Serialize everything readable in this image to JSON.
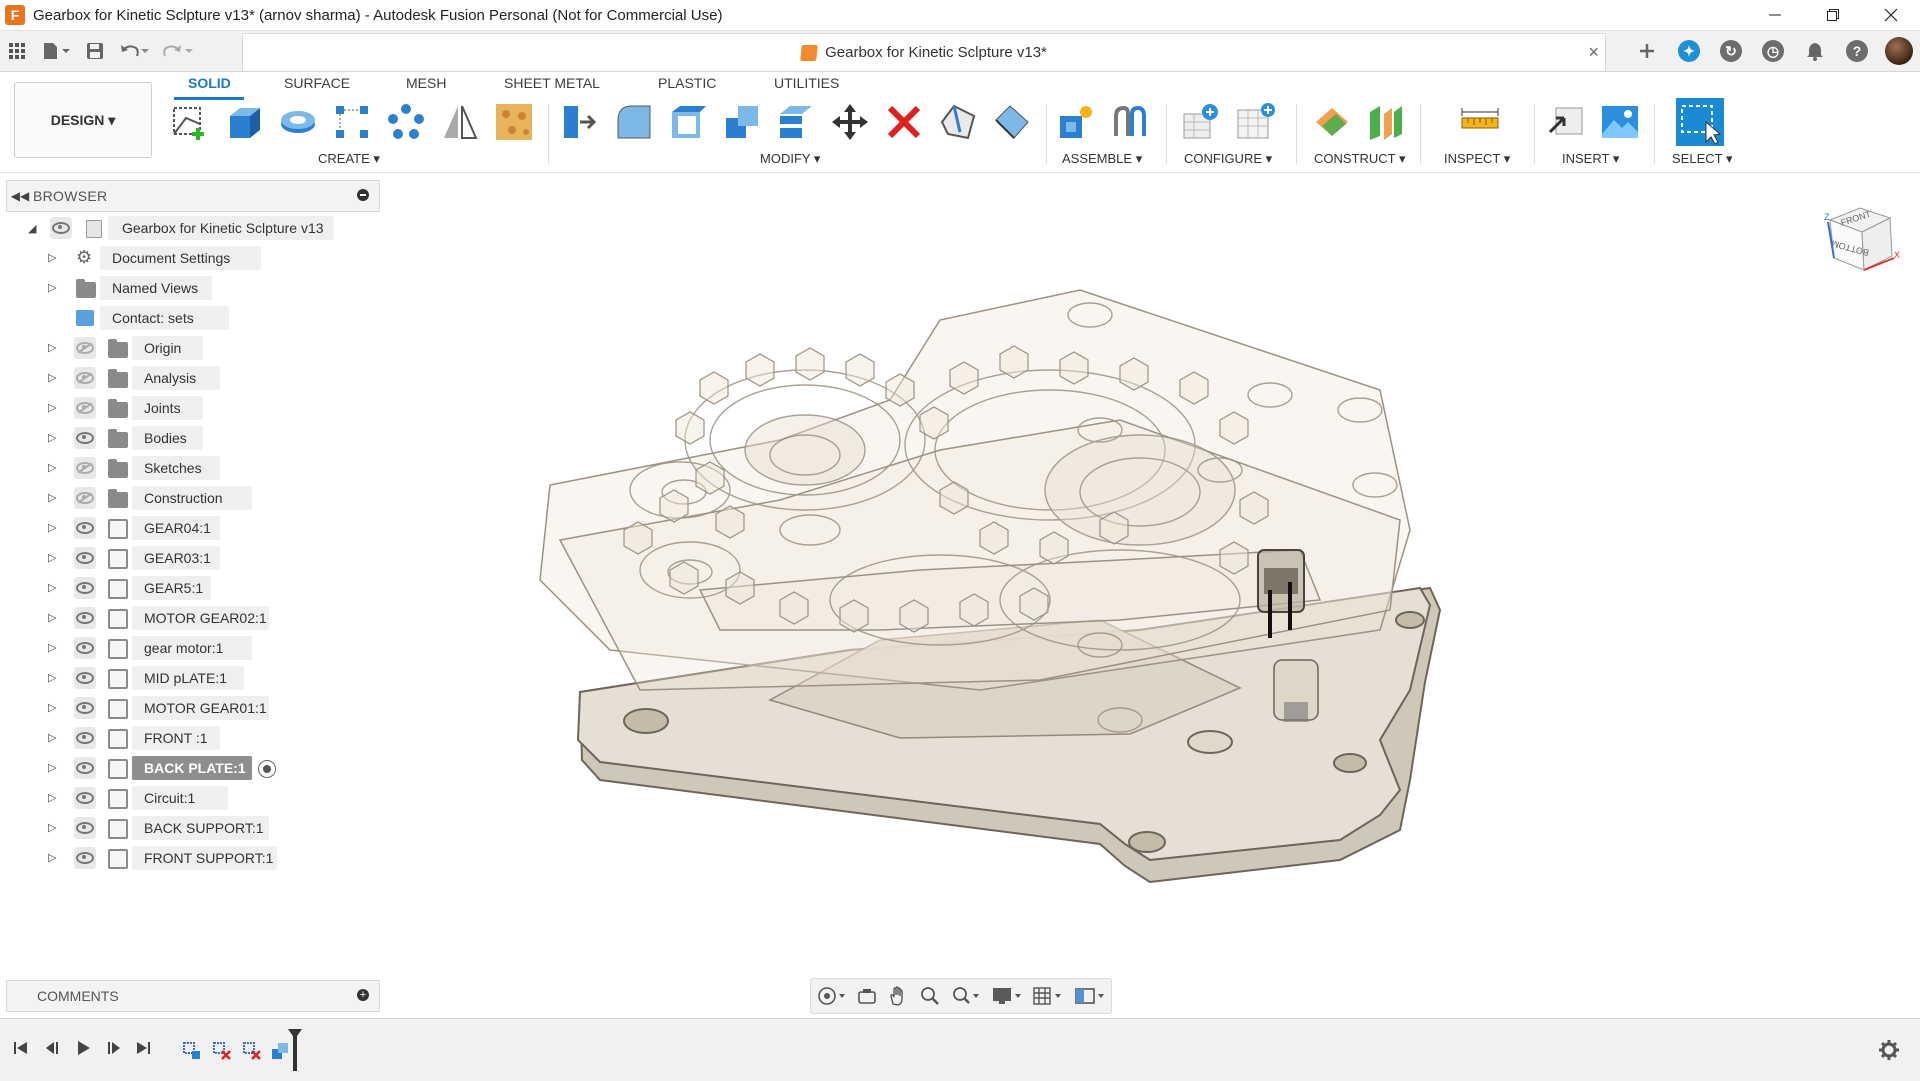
{
  "window": {
    "title": "Gearbox for Kinetic Sclpture v13* (arnov sharma) - Autodesk Fusion Personal (Not for Commercial Use)",
    "app_icon_letter": "F",
    "controls": [
      "minimize",
      "restore",
      "close"
    ]
  },
  "document_tab": {
    "title": "Gearbox for Kinetic Sclpture v13*",
    "close": "×"
  },
  "workspace": {
    "label": "DESIGN ▾"
  },
  "ribbon_tabs": [
    {
      "label": "SOLID",
      "active": true
    },
    {
      "label": "SURFACE",
      "active": false
    },
    {
      "label": "MESH",
      "active": false
    },
    {
      "label": "SHEET METAL",
      "active": false
    },
    {
      "label": "PLASTIC",
      "active": false
    },
    {
      "label": "UTILITIES",
      "active": false
    }
  ],
  "tool_groups": {
    "create": "CREATE ▾",
    "modify": "MODIFY ▾",
    "assemble": "ASSEMBLE ▾",
    "configure": "CONFIGURE ▾",
    "construct": "CONSTRUCT ▾",
    "inspect": "INSPECT ▾",
    "insert": "INSERT ▾",
    "select": "SELECT ▾"
  },
  "browser": {
    "header": "BROWSER",
    "root": "Gearbox for Kinetic Sclpture v13",
    "items": [
      {
        "label": "Document Settings",
        "icon": "gear-icon"
      },
      {
        "label": "Named Views",
        "icon": "folder-icon"
      },
      {
        "label": "Contact: sets",
        "icon": "contact-sets-icon"
      },
      {
        "label": "Origin",
        "icon": "folder-icon",
        "visible": false
      },
      {
        "label": "Analysis",
        "icon": "folder-icon",
        "visible": false
      },
      {
        "label": "Joints",
        "icon": "folder-icon",
        "visible": false
      },
      {
        "label": "Bodies",
        "icon": "folder-icon",
        "visible": true
      },
      {
        "label": "Sketches",
        "icon": "folder-icon",
        "visible": false
      },
      {
        "label": "Construction",
        "icon": "folder-icon",
        "visible": false
      },
      {
        "label": "GEAR04:1",
        "icon": "component-icon",
        "visible": true
      },
      {
        "label": "GEAR03:1",
        "icon": "component-icon",
        "visible": true
      },
      {
        "label": "GEAR5:1",
        "icon": "component-icon",
        "visible": true
      },
      {
        "label": "MOTOR GEAR02:1",
        "icon": "component-icon",
        "visible": true
      },
      {
        "label": "gear motor:1",
        "icon": "component-icon",
        "visible": true
      },
      {
        "label": "MID pLATE:1",
        "icon": "component-icon",
        "visible": true
      },
      {
        "label": "MOTOR GEAR01:1",
        "icon": "component-icon",
        "visible": true
      },
      {
        "label": "FRONT :1",
        "icon": "component-icon",
        "visible": true
      },
      {
        "label": "BACK PLATE:1",
        "icon": "component-icon",
        "visible": true,
        "selected": true
      },
      {
        "label": "Circuit:1",
        "icon": "component-icon",
        "visible": true
      },
      {
        "label": "BACK SUPPORT:1",
        "icon": "component-icon",
        "visible": true
      },
      {
        "label": "FRONT SUPPORT:1",
        "icon": "component-icon",
        "visible": true
      }
    ]
  },
  "comments": {
    "label": "COMMENTS"
  },
  "viewcube": {
    "front": "FRONT",
    "bottom": "BOTTOM",
    "axis_x": "X",
    "axis_z": "Z"
  },
  "colors": {
    "accent": "#1e78c8",
    "selected_row": "#8e8e8e",
    "model_fill": "#e6dfd3",
    "model_edge": "#6e655a"
  }
}
